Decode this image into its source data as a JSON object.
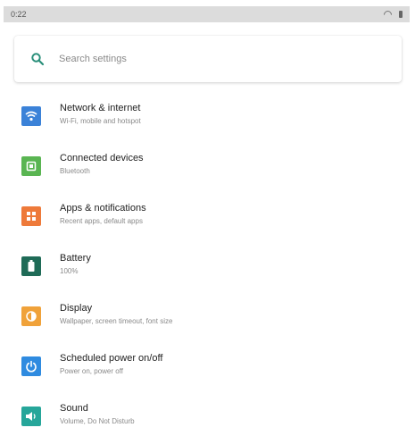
{
  "status_bar": {
    "time": "0:22"
  },
  "search": {
    "placeholder": "Search settings"
  },
  "colors": {
    "network": "#3b82d8",
    "connected": "#5ab552",
    "apps": "#ee7a3a",
    "battery": "#1f6b57",
    "display": "#f0a23a",
    "power": "#2f8be0",
    "sound": "#26a69a",
    "search_icon": "#2a8f7a"
  },
  "settings": [
    {
      "title": "Network & internet",
      "subtitle": "Wi-Fi, mobile and hotspot",
      "icon": "wifi-icon"
    },
    {
      "title": "Connected devices",
      "subtitle": "Bluetooth",
      "icon": "connected-devices-icon"
    },
    {
      "title": "Apps & notifications",
      "subtitle": "Recent apps, default apps",
      "icon": "apps-icon"
    },
    {
      "title": "Battery",
      "subtitle": "100%",
      "icon": "battery-icon"
    },
    {
      "title": "Display",
      "subtitle": "Wallpaper, screen timeout, font size",
      "icon": "display-icon"
    },
    {
      "title": "Scheduled power on/off",
      "subtitle": "Power on, power off",
      "icon": "power-icon"
    },
    {
      "title": "Sound",
      "subtitle": "Volume, Do Not Disturb",
      "icon": "sound-icon"
    }
  ]
}
